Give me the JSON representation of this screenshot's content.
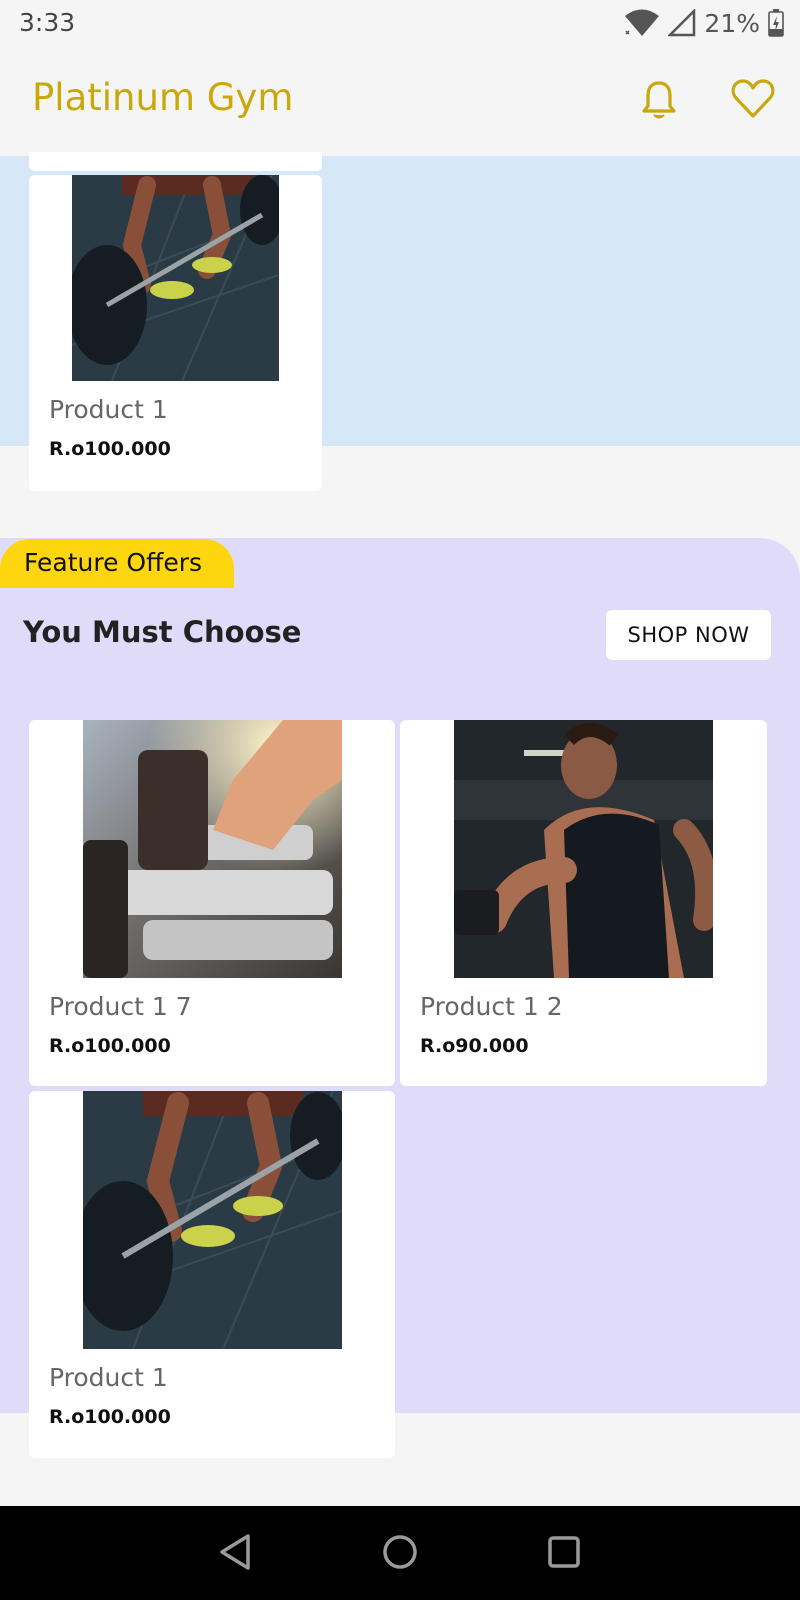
{
  "status_bar": {
    "time": "3:33",
    "battery": "21%"
  },
  "app_bar": {
    "title": "Platinum Gym",
    "title_color": "#c9a80c",
    "actions": [
      "bell-icon",
      "heart-icon"
    ]
  },
  "top_section": {
    "background": "#d6e8f8",
    "products": [
      {
        "name": "Product 1",
        "price": "R.o100.000",
        "image": "deadlift-barbell-photo"
      }
    ]
  },
  "feature_section": {
    "tag": "Feature Offers",
    "title": "You Must Choose",
    "button": "SHOP NOW",
    "background": "#e0dbf9",
    "tag_color": "#fdd60f",
    "products": [
      {
        "name": "Product 1 7",
        "price": "R.o100.000",
        "image": "dumbbell-rack-photo"
      },
      {
        "name": "Product 1 2",
        "price": "R.o90.000",
        "image": "man-bicep-curl-photo"
      },
      {
        "name": "Product 1",
        "price": "R.o100.000",
        "image": "deadlift-barbell-photo"
      }
    ]
  },
  "nav_bar": {
    "buttons": [
      "back-icon",
      "home-icon",
      "recents-icon"
    ]
  }
}
